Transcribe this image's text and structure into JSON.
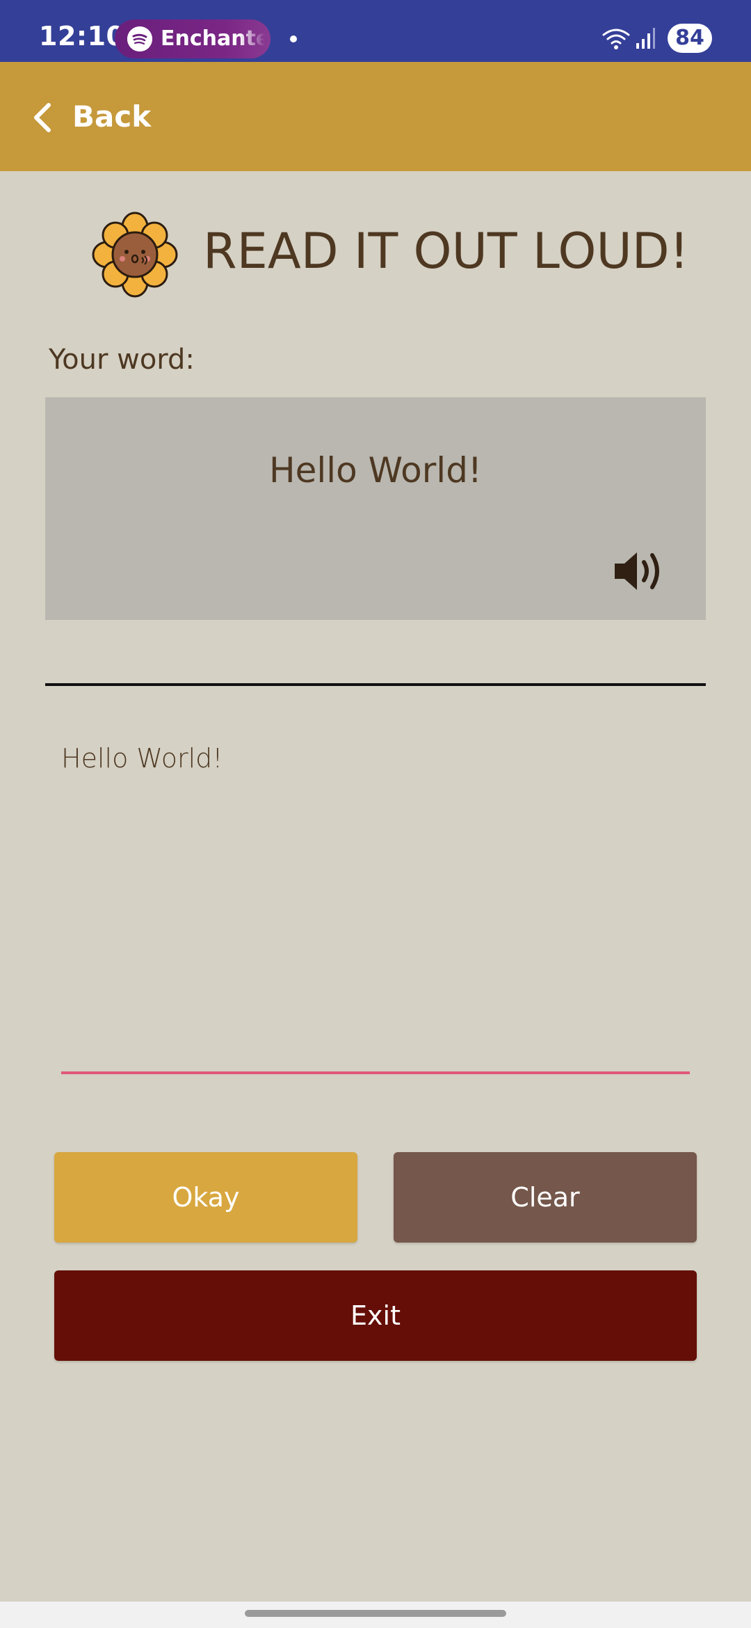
{
  "status_bar": {
    "time": "12:10",
    "media_app": "Enchante",
    "media_icon": "spotify-icon",
    "battery": "84",
    "colors": {
      "background": "#343f98",
      "media_pill": "#6a1f7c"
    }
  },
  "app_bar": {
    "back_label": "Back",
    "back_icon": "chevron-left-icon",
    "color": "#c6993b"
  },
  "page": {
    "title": "READ IT OUT LOUD!",
    "mascot_icon": "sunflower-icon",
    "word_label": "Your word:",
    "word": "Hello World!",
    "speaker_icon": "speaker-icon",
    "answer_value": "Hello World!"
  },
  "buttons": {
    "okay": "Okay",
    "clear": "Clear",
    "exit": "Exit",
    "colors": {
      "okay": "#d8a73f",
      "clear": "#75574b",
      "exit": "#640e07"
    }
  },
  "accent": {
    "input_underline": "#e0587a",
    "text": "#4e3822"
  }
}
